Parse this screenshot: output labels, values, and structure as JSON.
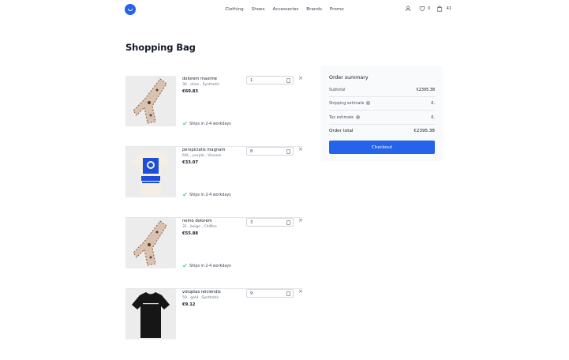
{
  "nav": {
    "links": [
      "Clothing",
      "Shoes",
      "Accessories",
      "Brands",
      "Promo"
    ],
    "wishlist_count": "0",
    "cart_count": "41"
  },
  "page": {
    "title": "Shopping Bag"
  },
  "items": [
    {
      "name": "dolorem maxime",
      "meta": "30 , olive , Synthetic",
      "price": "€60.83",
      "qty": "1",
      "shipping": "Ships in 2-4 workdays",
      "image": "scarf"
    },
    {
      "name": "perspiciatis magnam",
      "meta": "6XL , purple , Viscose",
      "price": "€33.07",
      "qty": "8",
      "shipping": "Ships in 2-4 workdays",
      "image": "tshirt-original"
    },
    {
      "name": "nemo dolorem",
      "meta": "31 , beige , Chiffon",
      "price": "€55.88",
      "qty": "3",
      "shipping": "Ships in 2-4 workdays",
      "image": "scarf"
    },
    {
      "name": "voluptas reiciendis",
      "meta": "50 , gold , Synthetic",
      "price": "€9.12",
      "qty": "9",
      "shipping": "",
      "image": "tshirt-black"
    }
  ],
  "summary": {
    "title": "Order summary",
    "subtotal_label": "Subtotal",
    "subtotal_value": "€2395.38",
    "shipping_label": "Shipping estimate",
    "shipping_value": "€.",
    "tax_label": "Tax estimate",
    "tax_value": "€.",
    "total_label": "Order total",
    "total_value": "€2395.38",
    "checkout_label": "Checkout"
  },
  "colors": {
    "accent": "#2563eb",
    "check": "#22c55e"
  }
}
